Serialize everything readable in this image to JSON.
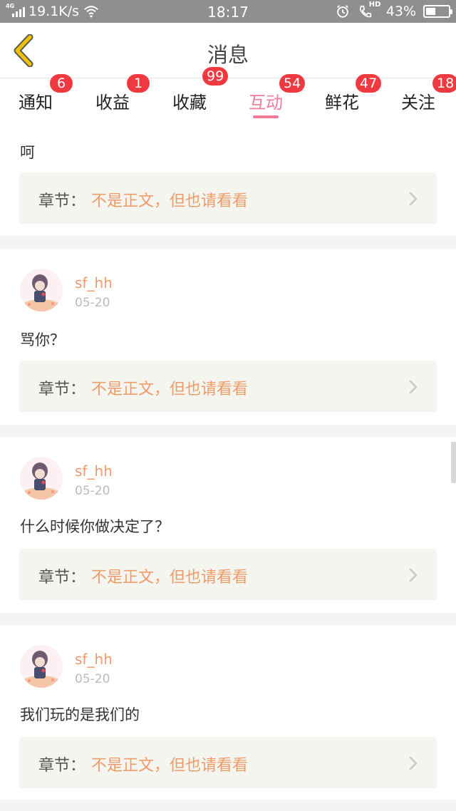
{
  "status": {
    "network_type": "4G",
    "net_speed": "19.1K/s",
    "time": "18:17",
    "signal_hd": "HD",
    "battery": "43%",
    "battery_level": 0.43
  },
  "header": {
    "title": "消息"
  },
  "tabs": [
    {
      "label": "通知",
      "badge": "6",
      "active": false
    },
    {
      "label": "收益",
      "badge": "1",
      "active": false
    },
    {
      "label": "收藏",
      "badge": "99",
      "active": false
    },
    {
      "label": "互动",
      "badge": "54",
      "active": true
    },
    {
      "label": "鲜花",
      "badge": "47",
      "active": false
    },
    {
      "label": "关注",
      "badge": "18",
      "active": false
    }
  ],
  "chapter_label": "章节：",
  "feed": [
    {
      "content": "呵",
      "chapter": "不是正文，但也请看看"
    },
    {
      "user": "sf_hh",
      "date": "05-20",
      "content": "骂你？",
      "chapter": "不是正文，但也请看看"
    },
    {
      "user": "sf_hh",
      "date": "05-20",
      "content": "什么时候你做决定了？",
      "chapter": "不是正文，但也请看看"
    },
    {
      "user": "sf_hh",
      "date": "05-20",
      "content": "我们玩的是我们的",
      "chapter": "不是正文，但也请看看"
    }
  ],
  "colors": {
    "accent_pink": "#f07c9a",
    "badge_red": "#f0383f",
    "orange_text": "#f09a6a",
    "back_yellow": "#f2c200"
  }
}
